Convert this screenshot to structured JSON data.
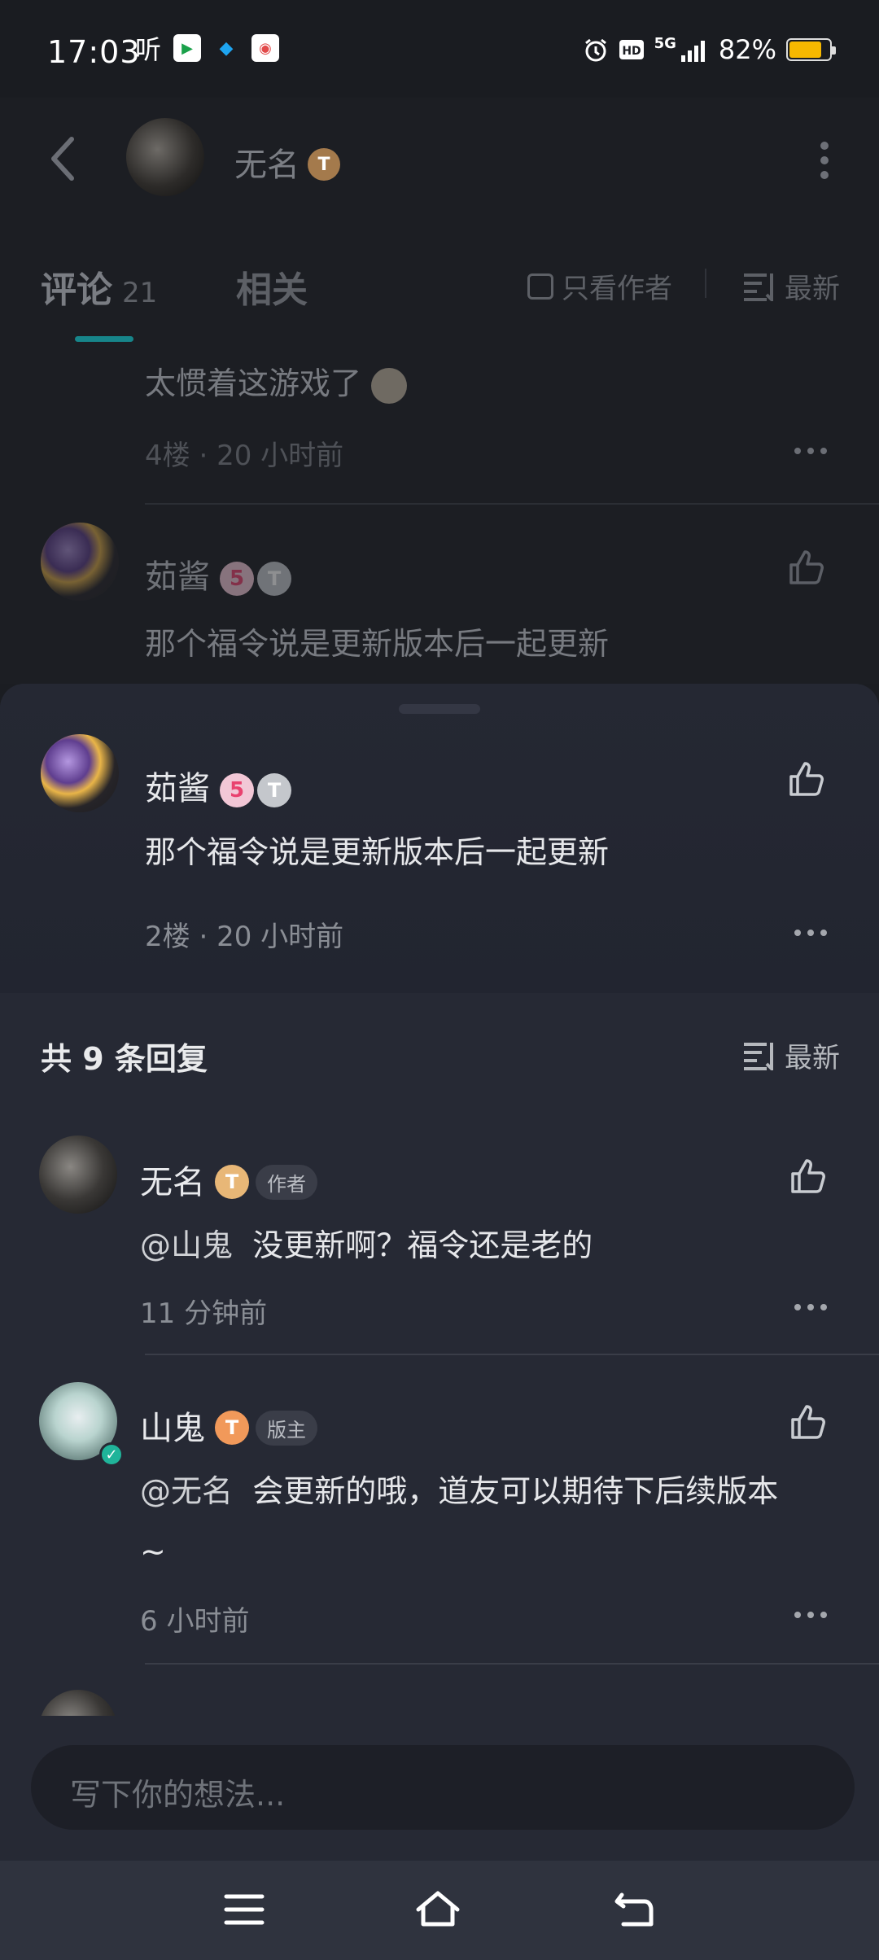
{
  "status_bar": {
    "time": "17:03",
    "notif1": "听",
    "notif2": "▶",
    "notif3": "◆",
    "notif4": "◉",
    "network": "5G",
    "battery_pct": "82%",
    "battery_level": 0.82
  },
  "header": {
    "title": "无名",
    "level_badge": "T",
    "icons": [
      "back-arrow-icon",
      "more-vertical-icon"
    ]
  },
  "tabs": {
    "comments_label": "评论",
    "comments_count": "21",
    "related_label": "相关",
    "author_only_label": "只看作者",
    "sort_label": "最新"
  },
  "background_list": {
    "prev_comment_text": "太惯着这游戏了",
    "prev_comment_meta_floor": "4楼",
    "prev_comment_meta_time": "20 小时前",
    "next_comment_name": "茹酱",
    "next_comment_text": "那个福令说是更新版本后一起更新"
  },
  "main_comment": {
    "name": "茹酱",
    "level_a": "5",
    "level_b": "T",
    "text": "那个福令说是更新版本后一起更新",
    "floor": "2楼",
    "time": "20 小时前"
  },
  "replies": {
    "header": "共 9 条回复",
    "sort_label": "最新",
    "items": [
      {
        "name": "无名",
        "level": "T",
        "role": "作者",
        "mention": "@山鬼",
        "text": "没更新啊？福令还是老的",
        "time": "11 分钟前"
      },
      {
        "name": "山鬼",
        "level": "T",
        "role": "版主",
        "mention": "@无名",
        "text": "会更新的哦，道友可以期待下后续版本",
        "text_cont": "~",
        "time": "6 小时前"
      }
    ]
  },
  "input": {
    "placeholder": "写下你的想法..."
  },
  "colors": {
    "accent": "#17858a",
    "sheet_bg": "#262934",
    "page_bg": "#1c1e23"
  }
}
